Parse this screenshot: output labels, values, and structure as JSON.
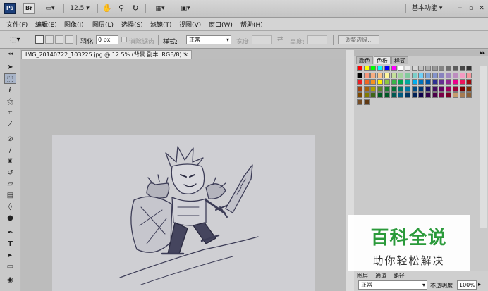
{
  "appbar": {
    "logo": "Ps",
    "br_label": "Br",
    "zoom": "12.5",
    "workspace": "基本功能"
  },
  "menu": [
    "文件(F)",
    "编辑(E)",
    "图像(I)",
    "图层(L)",
    "选择(S)",
    "滤镜(T)",
    "视图(V)",
    "窗口(W)",
    "帮助(H)"
  ],
  "options": {
    "feather_label": "羽化:",
    "feather_value": "0 px",
    "antialias_label": "消除锯齿",
    "style_label": "样式:",
    "style_value": "正常",
    "width_label": "宽度:",
    "height_label": "高度:",
    "refine_edge_label": "调整边缘..."
  },
  "document": {
    "tab_title": "IMG_20140722_103225.jpg @ 12.5% (背景 副本, RGB/8) *",
    "close_label": "×"
  },
  "panel": {
    "tabs": [
      "颜色",
      "色板",
      "样式"
    ],
    "active_tab": "色板",
    "bottom_tabs": [
      "图层",
      "通道",
      "路径"
    ],
    "blend_mode": "正常",
    "opacity_label": "不透明度:",
    "opacity_value": "100%"
  },
  "watermark": {
    "title": "百科全说",
    "subtitle": "助你轻松解决"
  },
  "colors": {
    "accent_green": "#2a9a3a",
    "ps_blue": "#1c3f7a"
  }
}
